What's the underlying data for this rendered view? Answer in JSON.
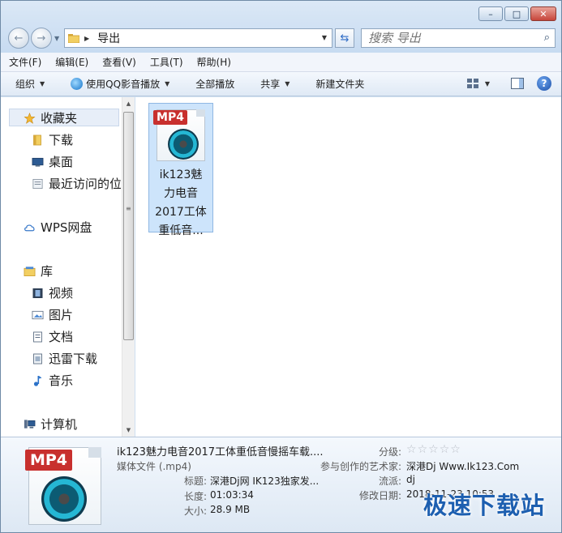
{
  "address": {
    "crumb": "导出"
  },
  "search": {
    "placeholder": "搜索 导出"
  },
  "menu": [
    "文件(F)",
    "编辑(E)",
    "查看(V)",
    "工具(T)",
    "帮助(H)"
  ],
  "toolbar": {
    "organize": "组织",
    "use_qq": "使用QQ影音播放",
    "play_all": "全部播放",
    "share": "共享",
    "new_folder": "新建文件夹"
  },
  "nav": {
    "favorites": "收藏夹",
    "downloads": "下载",
    "desktop": "桌面",
    "recent": "最近访问的位置",
    "wps": "WPS网盘",
    "library": "库",
    "videos": "视频",
    "pictures": "图片",
    "documents": "文档",
    "thunder": "迅雷下载",
    "music": "音乐",
    "computer": "计算机"
  },
  "file": {
    "badge": "MP4",
    "name_lines": [
      "ik123魅",
      "力电音",
      "2017工体",
      "重低音..."
    ]
  },
  "details": {
    "badge": "MP4",
    "filename": "ik123魅力电音2017工体重低音慢摇车载....",
    "type": "媒体文件 (.mp4)",
    "title_label": "标题:",
    "title_value": "深港Dj网 IK123独家发...",
    "length_label": "长度:",
    "length_value": "01:03:34",
    "size_label": "大小:",
    "size_value": "28.9 MB",
    "rating_label": "分级:",
    "rating_value": 0,
    "artist_label": "参与创作的艺术家:",
    "artist_value": "深港Dj Www.Ik123.Com",
    "genre_label": "流派:",
    "genre_value": "dj",
    "modified_label": "修改日期:",
    "modified_value": "2018-11-23 10:53"
  },
  "watermark": "极速下载站"
}
